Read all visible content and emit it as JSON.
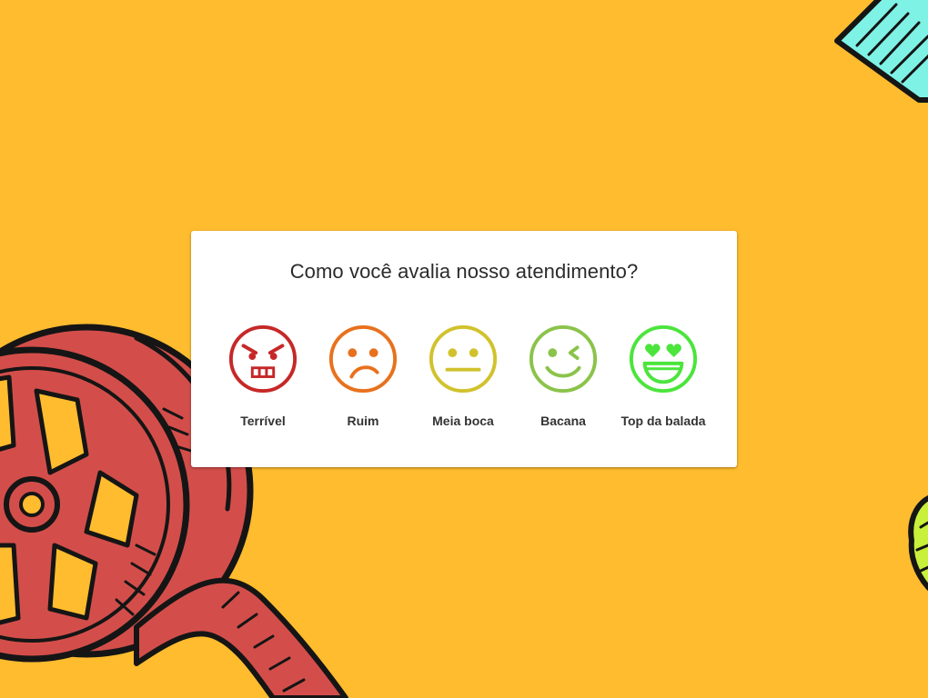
{
  "dialog": {
    "title": "Como você avalia nosso atendimento?"
  },
  "ratings": [
    {
      "label": "Terrível",
      "icon": "angry-face-icon",
      "color": "#C62828"
    },
    {
      "label": "Ruim",
      "icon": "sad-face-icon",
      "color": "#E8711D"
    },
    {
      "label": "Meia boca",
      "icon": "neutral-face-icon",
      "color": "#D1C22D"
    },
    {
      "label": "Bacana",
      "icon": "winking-face-icon",
      "color": "#8BC34A"
    },
    {
      "label": "Top da balada",
      "icon": "heart-eyes-face-icon",
      "color": "#4BE53C"
    }
  ],
  "background": {
    "color": "#FFBC2E",
    "decorations": [
      "film-reel-illustration",
      "ticket-illustration",
      "popcorn-illustration"
    ]
  }
}
